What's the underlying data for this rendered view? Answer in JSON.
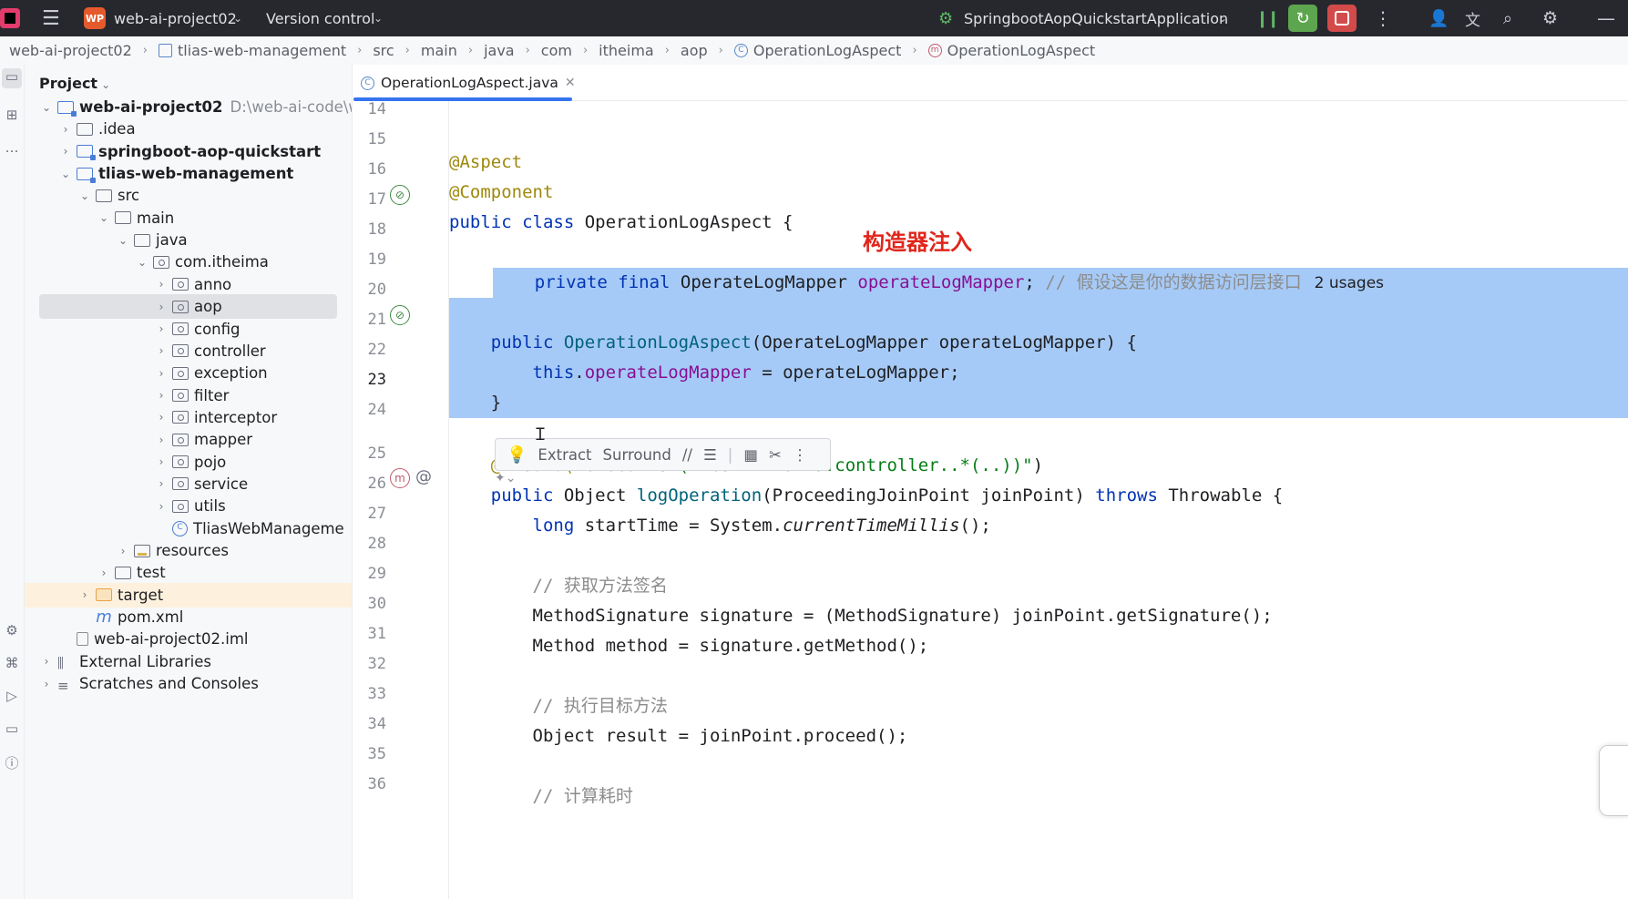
{
  "titlebar": {
    "project_badge": "WP",
    "project_name": "web-ai-project02",
    "version_control": "Version control",
    "run_config": "SpringbootAopQuickstartApplication"
  },
  "breadcrumb": [
    "web-ai-project02",
    "tlias-web-management",
    "src",
    "main",
    "java",
    "com",
    "itheima",
    "aop",
    "OperationLogAspect",
    "OperationLogAspect"
  ],
  "project_panel": {
    "title": "Project",
    "tree": [
      {
        "label": "web-ai-project02",
        "extra": "D:\\web-ai-code\\we",
        "depth": 0,
        "exp": "v",
        "kind": "mod",
        "bold": true
      },
      {
        "label": ".idea",
        "depth": 1,
        "exp": ">",
        "kind": "folder"
      },
      {
        "label": "springboot-aop-quickstart",
        "depth": 1,
        "exp": ">",
        "kind": "mod",
        "bold": true
      },
      {
        "label": "tlias-web-management",
        "depth": 1,
        "exp": "v",
        "kind": "mod",
        "bold": true
      },
      {
        "label": "src",
        "depth": 2,
        "exp": "v",
        "kind": "folder"
      },
      {
        "label": "main",
        "depth": 3,
        "exp": "v",
        "kind": "folder"
      },
      {
        "label": "java",
        "depth": 4,
        "exp": "v",
        "kind": "folder"
      },
      {
        "label": "com.itheima",
        "depth": 5,
        "exp": "v",
        "kind": "pkg"
      },
      {
        "label": "anno",
        "depth": 6,
        "exp": ">",
        "kind": "pkg"
      },
      {
        "label": "aop",
        "depth": 6,
        "exp": ">",
        "kind": "pkg",
        "selected": true
      },
      {
        "label": "config",
        "depth": 6,
        "exp": ">",
        "kind": "pkg"
      },
      {
        "label": "controller",
        "depth": 6,
        "exp": ">",
        "kind": "pkg"
      },
      {
        "label": "exception",
        "depth": 6,
        "exp": ">",
        "kind": "pkg"
      },
      {
        "label": "filter",
        "depth": 6,
        "exp": ">",
        "kind": "pkg"
      },
      {
        "label": "interceptor",
        "depth": 6,
        "exp": ">",
        "kind": "pkg"
      },
      {
        "label": "mapper",
        "depth": 6,
        "exp": ">",
        "kind": "pkg"
      },
      {
        "label": "pojo",
        "depth": 6,
        "exp": ">",
        "kind": "pkg"
      },
      {
        "label": "service",
        "depth": 6,
        "exp": ">",
        "kind": "pkg"
      },
      {
        "label": "utils",
        "depth": 6,
        "exp": ">",
        "kind": "pkg"
      },
      {
        "label": "TliasWebManageme",
        "depth": 6,
        "exp": "",
        "kind": "class"
      },
      {
        "label": "resources",
        "depth": 4,
        "exp": ">",
        "kind": "res"
      },
      {
        "label": "test",
        "depth": 3,
        "exp": ">",
        "kind": "folder"
      },
      {
        "label": "target",
        "depth": 2,
        "exp": ">",
        "kind": "orange",
        "highlight": true
      },
      {
        "label": "pom.xml",
        "depth": 2,
        "exp": "",
        "kind": "maven"
      },
      {
        "label": "web-ai-project02.iml",
        "depth": 1,
        "exp": "",
        "kind": "file"
      },
      {
        "label": "External Libraries",
        "depth": 0,
        "exp": ">",
        "kind": "lib"
      },
      {
        "label": "Scratches and Consoles",
        "depth": 0,
        "exp": ">",
        "kind": "lib"
      }
    ]
  },
  "editor": {
    "tab": "OperationLogAspect.java",
    "line_numbers": [
      "14",
      "15",
      "16",
      "17",
      "18",
      "19",
      "20",
      "21",
      "22",
      "23",
      "24",
      "25",
      "26",
      "27",
      "28",
      "29",
      "30",
      "31",
      "32",
      "33",
      "34",
      "35",
      "36"
    ],
    "annotation_overlay": "构造器注入",
    "popup": {
      "extract": "Extract",
      "surround": "Surround"
    },
    "code": {
      "l15": "@Aspect",
      "l16": "@Component",
      "l17": [
        "public class ",
        "OperationLogAspect {"
      ],
      "l19": [
        "private final ",
        "OperateLogMapper ",
        "operateLogMapper",
        ";",
        " // 假设这是你的数据访问层接口",
        "2 usages"
      ],
      "l21": [
        "public ",
        "OperationLogAspect",
        "(OperateLogMapper operateLogMapper) {"
      ],
      "l22": [
        "this",
        ".",
        "operateLogMapper",
        " = operateLogMapper;"
      ],
      "l23": "}",
      "l25": [
        "@Around(",
        "\"execution(* com.itheima.controller..*(..))\"",
        ")"
      ],
      "l26": [
        "public ",
        "Object ",
        "logOperation",
        "(ProceedingJoinPoint joinPoint) ",
        "throws ",
        "Throwable {"
      ],
      "l27": [
        "long ",
        "startTime = System.",
        "currentTimeMillis",
        "();"
      ],
      "l29": "// 获取方法签名",
      "l30": "MethodSignature signature = (MethodSignature) joinPoint.getSignature();",
      "l31": "Method method = signature.getMethod();",
      "l33": "// 执行目标方法",
      "l34": "Object result = joinPoint.proceed();",
      "l36": "// 计算耗时"
    }
  }
}
